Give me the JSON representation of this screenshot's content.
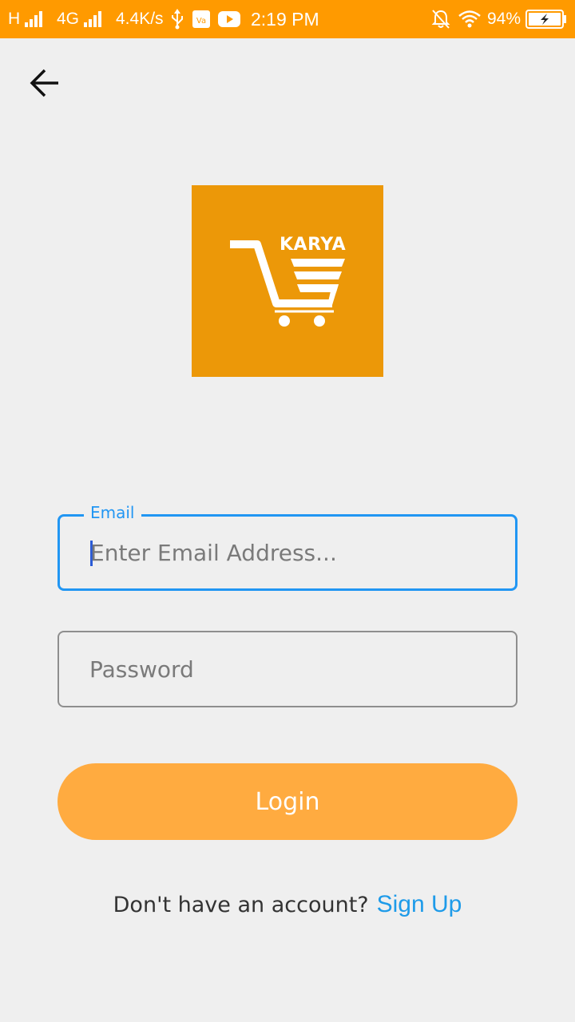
{
  "status_bar": {
    "network_h": "H",
    "network_4g": "4G",
    "speed": "4.4K/s",
    "time": "2:19 PM",
    "battery": "94%",
    "icons": [
      "signal-icon",
      "usb-icon",
      "vpn-icon",
      "youtube-icon",
      "notifications-off-icon",
      "wifi-icon",
      "battery-charging-icon"
    ]
  },
  "nav": {
    "back_icon": "arrow-back-icon"
  },
  "logo": {
    "text": "KARYA",
    "icon": "shopping-cart-icon"
  },
  "email": {
    "label": "Email",
    "placeholder": "Enter Email Address..."
  },
  "password": {
    "placeholder": "Password"
  },
  "login": {
    "label": "Login"
  },
  "signup": {
    "prompt": "Don't have an account?",
    "link": "Sign Up"
  },
  "colors": {
    "status_bar": "#ff9a00",
    "logo_bg": "#ec9808",
    "focus": "#2196f3",
    "login_button": "#ffab40",
    "link": "#1e9be9"
  }
}
